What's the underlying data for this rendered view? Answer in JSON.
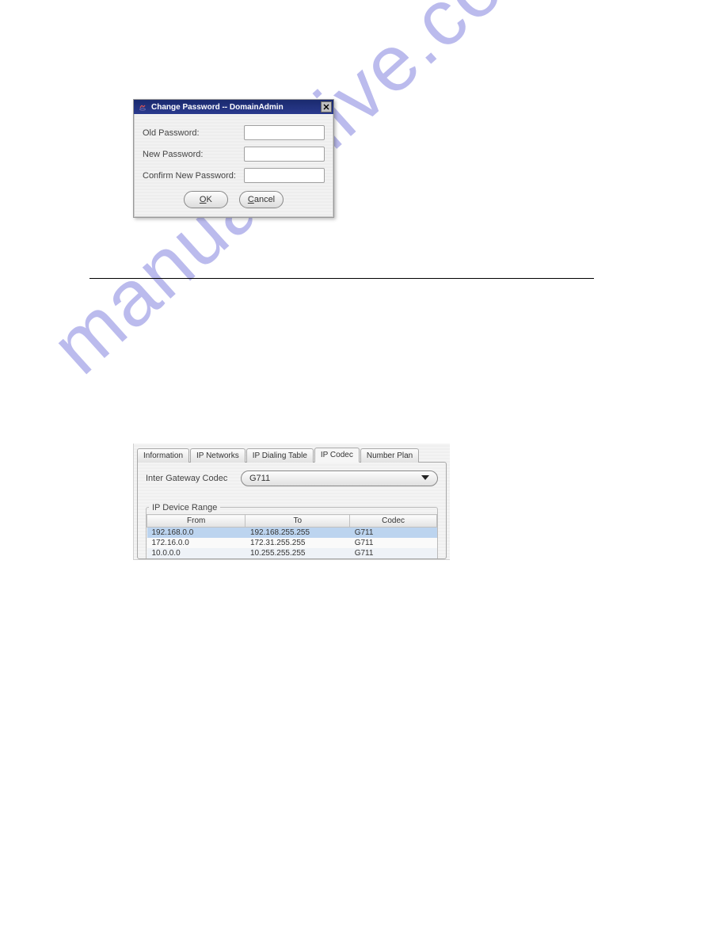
{
  "pw_dialog": {
    "title": "Change Password -- DomainAdmin",
    "fields": [
      {
        "label": "Old Password:"
      },
      {
        "label": "New Password:"
      },
      {
        "label": "Confirm New Password:"
      }
    ],
    "ok": "OK",
    "cancel": "Cancel"
  },
  "tab_panel": {
    "tabs": [
      "Information",
      "IP Networks",
      "IP Dialing Table",
      "IP Codec",
      "Number Plan"
    ],
    "active_tab": "IP Codec",
    "inter_gateway_label": "Inter Gateway Codec",
    "inter_gateway_value": "G711",
    "group_label": "IP Device Range",
    "columns": [
      "From",
      "To",
      "Codec"
    ],
    "rows": [
      {
        "from": "192.168.0.0",
        "to": "192.168.255.255",
        "codec": "G711"
      },
      {
        "from": "172.16.0.0",
        "to": "172.31.255.255",
        "codec": "G711"
      },
      {
        "from": "10.0.0.0",
        "to": "10.255.255.255",
        "codec": "G711"
      }
    ]
  },
  "watermark": "manualshive.com"
}
